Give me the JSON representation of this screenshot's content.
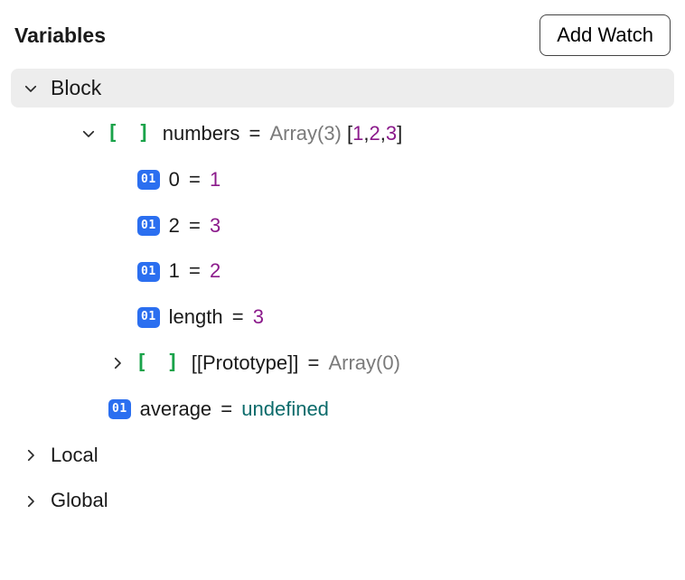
{
  "header": {
    "title": "Variables",
    "add_watch_label": "Add Watch"
  },
  "block": {
    "label": "Block",
    "numbers": {
      "name": "numbers",
      "type_label": "Array(3)",
      "summary_vals": [
        "1",
        "2",
        "3"
      ],
      "entries": [
        {
          "key": "0",
          "value": "1"
        },
        {
          "key": "2",
          "value": "3"
        },
        {
          "key": "1",
          "value": "2"
        },
        {
          "key": "length",
          "value": "3"
        }
      ],
      "prototype": {
        "name": "[[Prototype]]",
        "type_label": "Array(0)"
      }
    },
    "average": {
      "name": "average",
      "value": "undefined"
    }
  },
  "scopes": {
    "local": "Local",
    "global": "Global"
  },
  "icons": {
    "array": "[ ]",
    "num_badge": "01"
  }
}
